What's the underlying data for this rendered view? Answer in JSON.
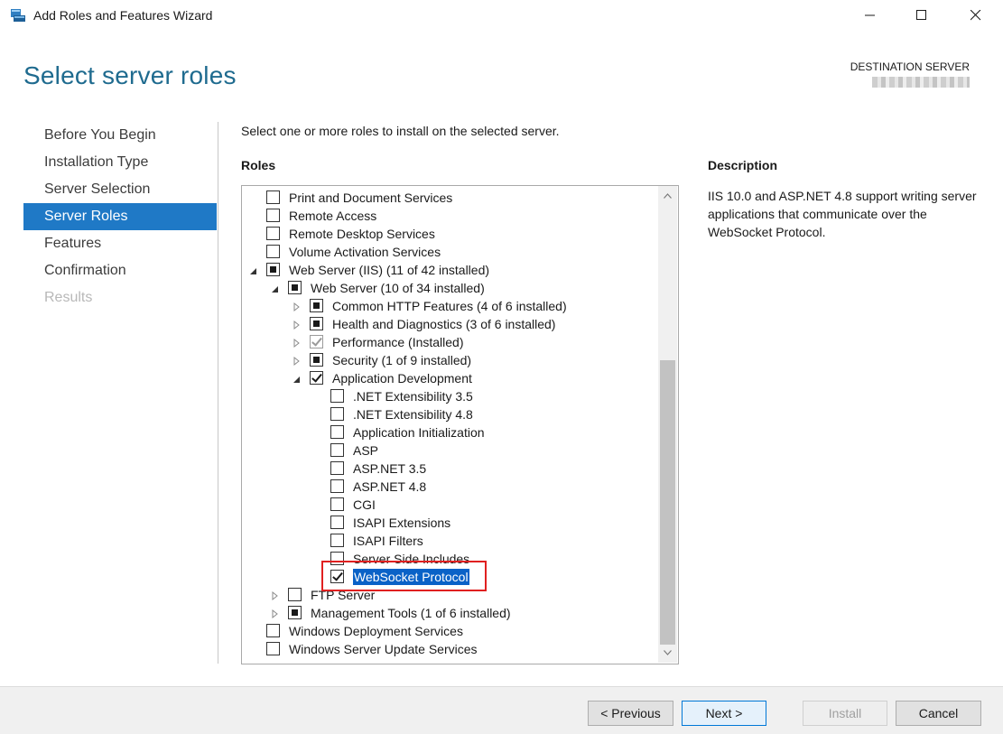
{
  "window": {
    "title": "Add Roles and Features Wizard"
  },
  "header": {
    "page_title": "Select server roles",
    "destination_label": "DESTINATION SERVER"
  },
  "nav": {
    "items": [
      {
        "label": "Before You Begin",
        "state": "normal"
      },
      {
        "label": "Installation Type",
        "state": "normal"
      },
      {
        "label": "Server Selection",
        "state": "normal"
      },
      {
        "label": "Server Roles",
        "state": "active"
      },
      {
        "label": "Features",
        "state": "normal"
      },
      {
        "label": "Confirmation",
        "state": "normal"
      },
      {
        "label": "Results",
        "state": "disabled"
      }
    ]
  },
  "content": {
    "instruction": "Select one or more roles to install on the selected server.",
    "roles_heading": "Roles",
    "description_heading": "Description",
    "description_text": "IIS 10.0 and ASP.NET 4.8 support writing server applications that communicate over the WebSocket Protocol."
  },
  "roles_tree": [
    {
      "label": "Print and Document Services",
      "level": 0,
      "expander": "none",
      "check": "unchecked"
    },
    {
      "label": "Remote Access",
      "level": 0,
      "expander": "none",
      "check": "unchecked"
    },
    {
      "label": "Remote Desktop Services",
      "level": 0,
      "expander": "none",
      "check": "unchecked"
    },
    {
      "label": "Volume Activation Services",
      "level": 0,
      "expander": "none",
      "check": "unchecked"
    },
    {
      "label": "Web Server (IIS) (11 of 42 installed)",
      "level": 0,
      "expander": "expanded",
      "check": "partial"
    },
    {
      "label": "Web Server (10 of 34 installed)",
      "level": 1,
      "expander": "expanded",
      "check": "partial"
    },
    {
      "label": "Common HTTP Features (4 of 6 installed)",
      "level": 2,
      "expander": "collapsed",
      "check": "partial"
    },
    {
      "label": "Health and Diagnostics (3 of 6 installed)",
      "level": 2,
      "expander": "collapsed",
      "check": "partial"
    },
    {
      "label": "Performance (Installed)",
      "level": 2,
      "expander": "collapsed",
      "check": "checked-grey"
    },
    {
      "label": "Security (1 of 9 installed)",
      "level": 2,
      "expander": "collapsed",
      "check": "partial"
    },
    {
      "label": "Application Development",
      "level": 2,
      "expander": "expanded",
      "check": "checked"
    },
    {
      "label": ".NET Extensibility 3.5",
      "level": 3,
      "expander": "none",
      "check": "unchecked"
    },
    {
      "label": ".NET Extensibility 4.8",
      "level": 3,
      "expander": "none",
      "check": "unchecked"
    },
    {
      "label": "Application Initialization",
      "level": 3,
      "expander": "none",
      "check": "unchecked"
    },
    {
      "label": "ASP",
      "level": 3,
      "expander": "none",
      "check": "unchecked"
    },
    {
      "label": "ASP.NET 3.5",
      "level": 3,
      "expander": "none",
      "check": "unchecked"
    },
    {
      "label": "ASP.NET 4.8",
      "level": 3,
      "expander": "none",
      "check": "unchecked"
    },
    {
      "label": "CGI",
      "level": 3,
      "expander": "none",
      "check": "unchecked"
    },
    {
      "label": "ISAPI Extensions",
      "level": 3,
      "expander": "none",
      "check": "unchecked"
    },
    {
      "label": "ISAPI Filters",
      "level": 3,
      "expander": "none",
      "check": "unchecked"
    },
    {
      "label": "Server Side Includes",
      "level": 3,
      "expander": "none",
      "check": "unchecked"
    },
    {
      "label": "WebSocket Protocol",
      "level": 3,
      "expander": "none",
      "check": "checked",
      "selected": true
    },
    {
      "label": "FTP Server",
      "level": 1,
      "expander": "collapsed",
      "check": "unchecked"
    },
    {
      "label": "Management Tools (1 of 6 installed)",
      "level": 1,
      "expander": "collapsed",
      "check": "partial"
    },
    {
      "label": "Windows Deployment Services",
      "level": 0,
      "expander": "none",
      "check": "unchecked"
    },
    {
      "label": "Windows Server Update Services",
      "level": 0,
      "expander": "none",
      "check": "unchecked"
    }
  ],
  "footer": {
    "previous_label": "< Previous",
    "next_label": "Next >",
    "install_label": "Install",
    "cancel_label": "Cancel"
  },
  "colors": {
    "accent": "#1f79c6",
    "title_blue": "#1f6b8f",
    "selection": "#0a62c7",
    "highlight_border": "#e02020"
  },
  "icons": [
    "server-manager-icon",
    "minimize-icon",
    "maximize-icon",
    "close-icon",
    "expand-arrow-icon",
    "collapse-arrow-icon",
    "scroll-up-icon",
    "scroll-down-icon"
  ]
}
